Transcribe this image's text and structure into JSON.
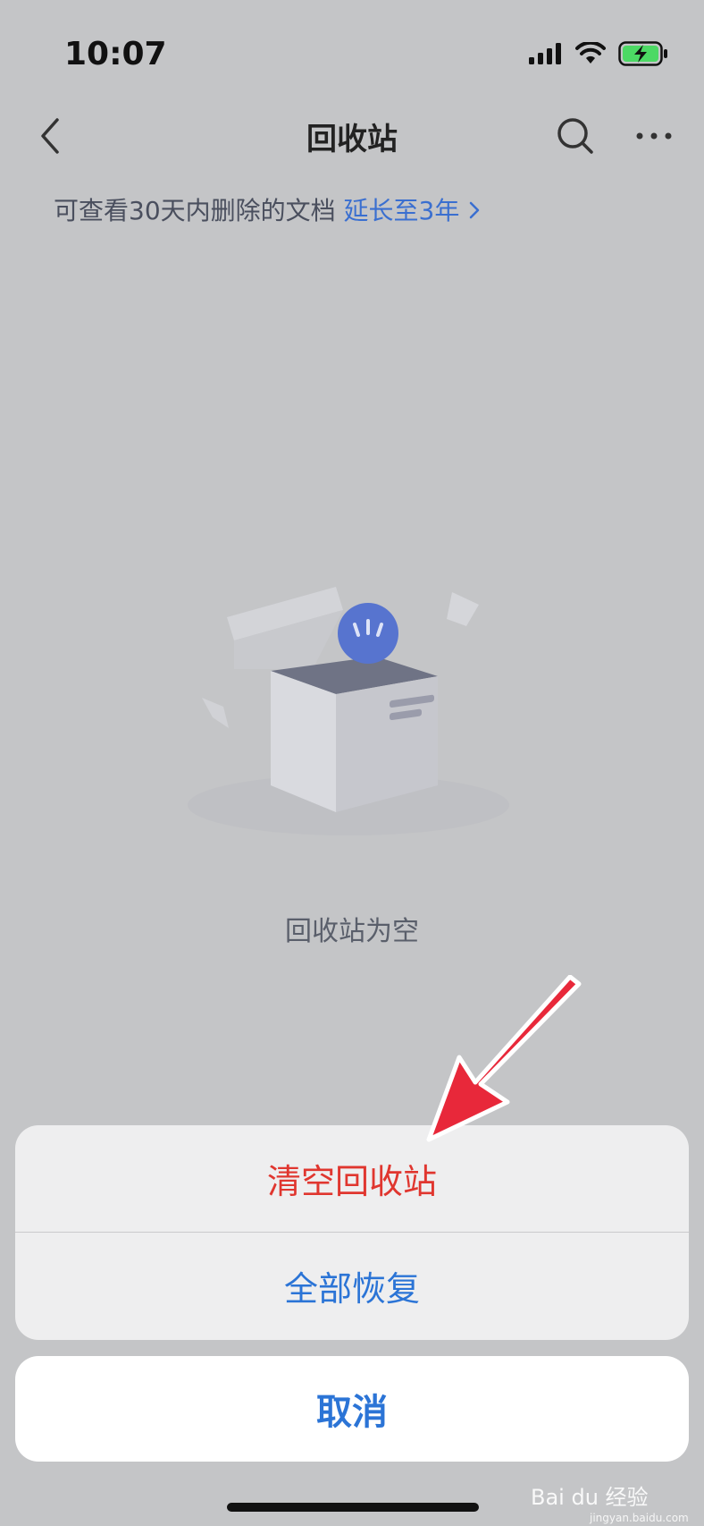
{
  "status_bar": {
    "time": "10:07",
    "icons": [
      "cellular-signal-icon",
      "wifi-icon",
      "battery-charging-icon"
    ]
  },
  "nav": {
    "title": "回收站",
    "back_icon": "chevron-left-icon",
    "search_icon": "search-icon",
    "more_icon": "more-dots-icon"
  },
  "notice": {
    "text": "可查看30天内删除的文档",
    "link": "延长至3年",
    "link_icon": "chevron-right-icon"
  },
  "empty_state": {
    "illustration": "open-box-icon",
    "text": "回收站为空"
  },
  "action_sheet": {
    "clear_label": "清空回收站",
    "restore_label": "全部恢复",
    "cancel_label": "取消"
  },
  "colors": {
    "danger": "#e0362f",
    "primary": "#2b74d6",
    "link": "#3a6fd0",
    "annotation_arrow": "#e8283a"
  },
  "watermark": {
    "main": "Bai du 经验",
    "sub": "jingyan.baidu.com"
  }
}
